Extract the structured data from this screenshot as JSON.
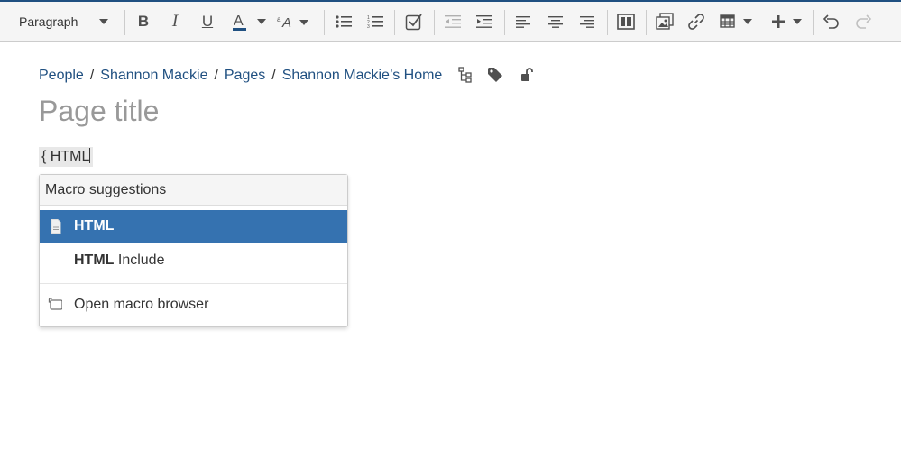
{
  "toolbar": {
    "paragraph_label": "Paragraph"
  },
  "breadcrumb": {
    "items": [
      "People",
      "Shannon Mackie",
      "Pages",
      "Shannon Mackie’s Home"
    ],
    "separator": "/"
  },
  "page": {
    "title_placeholder": "Page title",
    "macro_input": "{ HTML"
  },
  "macro_suggestions": {
    "header": "Macro suggestions",
    "items": [
      {
        "bold": "HTML",
        "rest": ""
      },
      {
        "bold": "HTML",
        "rest": " Include"
      }
    ],
    "browse_label": "Open macro browser"
  },
  "colors": {
    "accent": "#205081",
    "selected": "#3572b0",
    "text_color_underline": "#205081"
  }
}
